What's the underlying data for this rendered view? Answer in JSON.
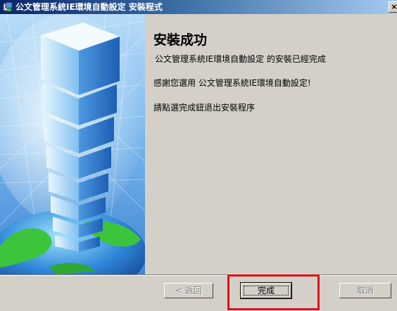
{
  "window": {
    "title": "公文管理系統IE環境自動設定 安裝程式",
    "close_glyph": "×"
  },
  "content": {
    "heading": "安裝成功",
    "line1": "公文管理系統IE環境自動設定 的安裝已經完成",
    "line2": "感謝您選用 公文管理系統IE環境自動設定!",
    "line3": "請點選完成鈕退出安裝程序"
  },
  "buttons": {
    "back": "< 返回",
    "finish": "完成",
    "cancel": "取消"
  },
  "colors": {
    "title_start": "#0a246a",
    "title_end": "#a6caf0",
    "dialog_bg": "#d4d0c8",
    "highlight": "#e0101a",
    "art_sky": "#5aa0e0",
    "art_green": "#34c83a"
  },
  "icons": [
    "installer-app-icon",
    "close-icon",
    "tower-globe-illustration"
  ]
}
